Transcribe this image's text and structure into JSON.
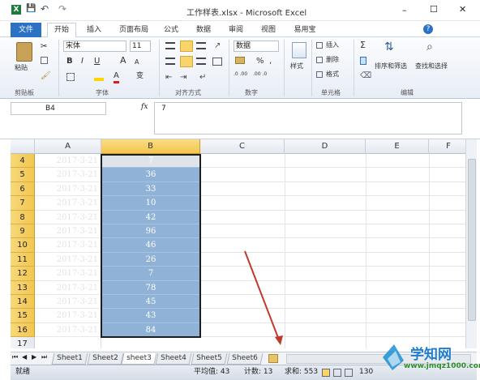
{
  "title": "工作样表.xlsx - Microsoft Excel",
  "window_controls": {
    "minimize": "–",
    "maximize": "☐",
    "close": "✕"
  },
  "qat": {
    "save": "💾",
    "undo": "↶",
    "redo": "↷"
  },
  "tabs": [
    "文件",
    "开始",
    "插入",
    "页面布局",
    "公式",
    "数据",
    "审阅",
    "视图",
    "易用宝"
  ],
  "ribbon": {
    "clipboard": {
      "paste": "粘贴",
      "label": "剪贴板"
    },
    "font": {
      "name": "宋体",
      "size": "11",
      "bold": "B",
      "italic": "I",
      "underline": "U",
      "grow": "A",
      "shrink": "A",
      "color_a": "A",
      "wen": "变",
      "label": "字体"
    },
    "align": {
      "label": "对齐方式"
    },
    "number": {
      "format": "数据",
      "percent": "%",
      "comma": ",",
      "inc": ".0 .00",
      "dec": ".00 .0",
      "label": "数字"
    },
    "styles": {
      "label": "样式",
      "btn": "样式"
    },
    "cells": {
      "insert": "插入",
      "delete": "删除",
      "format": "格式",
      "label": "单元格"
    },
    "edit": {
      "sigma": "Σ",
      "sort": "排序和筛选",
      "find": "查找和选择",
      "label": "编辑"
    }
  },
  "formula_bar": {
    "name_box": "B4",
    "fx": "fx",
    "value": "7"
  },
  "columns": [
    "A",
    "B",
    "C",
    "D",
    "E",
    "F"
  ],
  "rows": [
    {
      "n": "4",
      "a": "2017-3-21",
      "b": "7"
    },
    {
      "n": "5",
      "a": "2017-3-21",
      "b": "36"
    },
    {
      "n": "6",
      "a": "2017-3-21",
      "b": "33"
    },
    {
      "n": "7",
      "a": "2017-3-21",
      "b": "10"
    },
    {
      "n": "8",
      "a": "2017-3-21",
      "b": "42"
    },
    {
      "n": "9",
      "a": "2017-3-21",
      "b": "96"
    },
    {
      "n": "10",
      "a": "2017-3-21",
      "b": "46"
    },
    {
      "n": "11",
      "a": "2017-3-21",
      "b": "26"
    },
    {
      "n": "12",
      "a": "2017-3-21",
      "b": "7"
    },
    {
      "n": "13",
      "a": "2017-3-21",
      "b": "78"
    },
    {
      "n": "14",
      "a": "2017-3-21",
      "b": "45"
    },
    {
      "n": "15",
      "a": "2017-3-21",
      "b": "43"
    },
    {
      "n": "16",
      "a": "2017-3-21",
      "b": "84"
    },
    {
      "n": "17",
      "a": "",
      "b": ""
    }
  ],
  "sheets": [
    "Sheet1",
    "Sheet2",
    "sheet3",
    "Sheet4",
    "Sheet5",
    "Sheet6"
  ],
  "active_sheet": "sheet3",
  "status": {
    "ready": "就绪",
    "average": "平均值: 43",
    "count": "计数: 13",
    "sum": "求和: 553",
    "zoom": "130"
  },
  "watermark": {
    "brand": "学知网",
    "url": "www.jmqz1000.com"
  },
  "colors": {
    "accent": "#2b71c4",
    "selection": "#8fb2d6",
    "header_selected": "#f3c64f",
    "arrow": "#c0392b"
  }
}
